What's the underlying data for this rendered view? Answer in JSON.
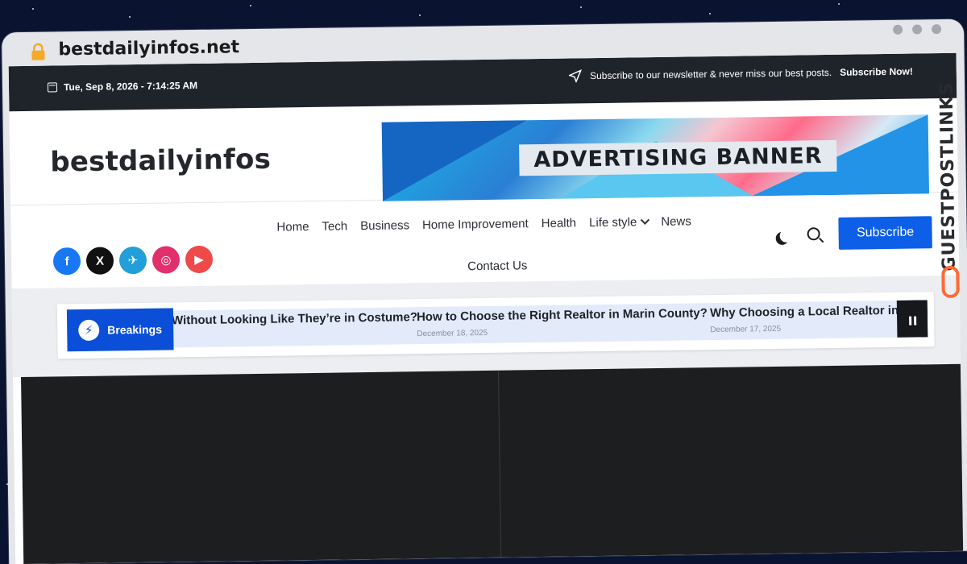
{
  "browser": {
    "url": "bestdailyinfos.net"
  },
  "topbar": {
    "date": "Tue, Sep 8, 2026 - 7:14:25 AM",
    "newsletter_text": "Subscribe to our newsletter & never miss our best posts.",
    "newsletter_cta": "Subscribe Now!"
  },
  "header": {
    "logo": "bestdailyinfos",
    "ad_label": "ADVERTISING BANNER"
  },
  "social": [
    "f",
    "X",
    "✈",
    "◎",
    "▶"
  ],
  "nav": {
    "items": [
      "Home",
      "Tech",
      "Business",
      "Home Improvement",
      "Health",
      "Life style",
      "News"
    ],
    "second_line": "Contact Us",
    "subscribe": "Subscribe"
  },
  "breaking": {
    "label": "Breakings",
    "items": [
      {
        "title": "Without Looking Like They’re in Costume?",
        "date": ""
      },
      {
        "title": "How to Choose the Right Realtor in Marin County?",
        "date": "December 18, 2025"
      },
      {
        "title": "Why Choosing a Local Realtor in M",
        "date": "December 17, 2025"
      }
    ]
  },
  "sidebrand": "GUESTPOSTLINKS"
}
